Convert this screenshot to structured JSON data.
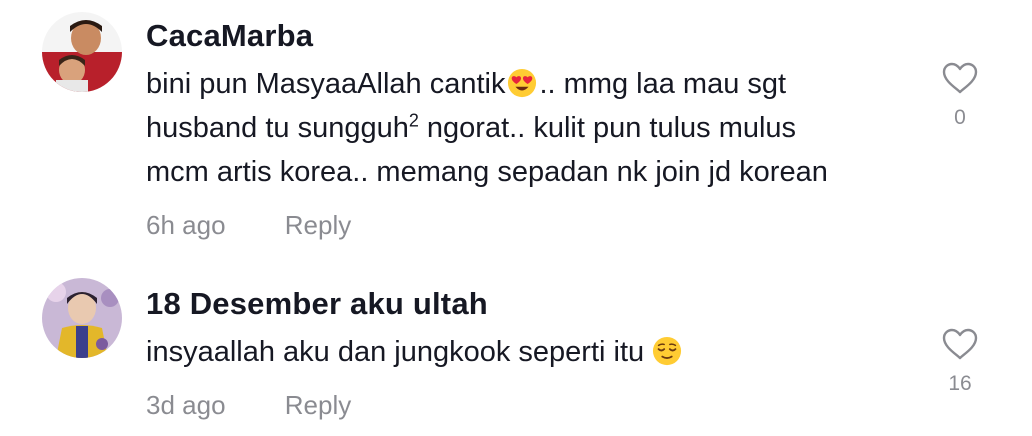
{
  "comments": [
    {
      "username": "CacaMarba",
      "text_lines": [
        {
          "before": "bini pun MasyaaAllah cantik",
          "after": ".. mmg laa mau sgt"
        },
        {
          "before": "husband tu sungguh",
          "sup": "2",
          "after": " ngorat.. kulit pun tulus mulus"
        },
        {
          "before": "mcm artis korea.. memang sepadan nk join jd korean"
        }
      ],
      "emoji": "heart-eyes-emoji",
      "time": "6h ago",
      "reply_label": "Reply",
      "like_count": "0"
    },
    {
      "username": "18 Desember aku ultah",
      "text": "insyaallah aku dan jungkook seperti itu",
      "emoji": "relieved-face-emoji",
      "time": "3d ago",
      "reply_label": "Reply",
      "like_count": "16"
    }
  ]
}
